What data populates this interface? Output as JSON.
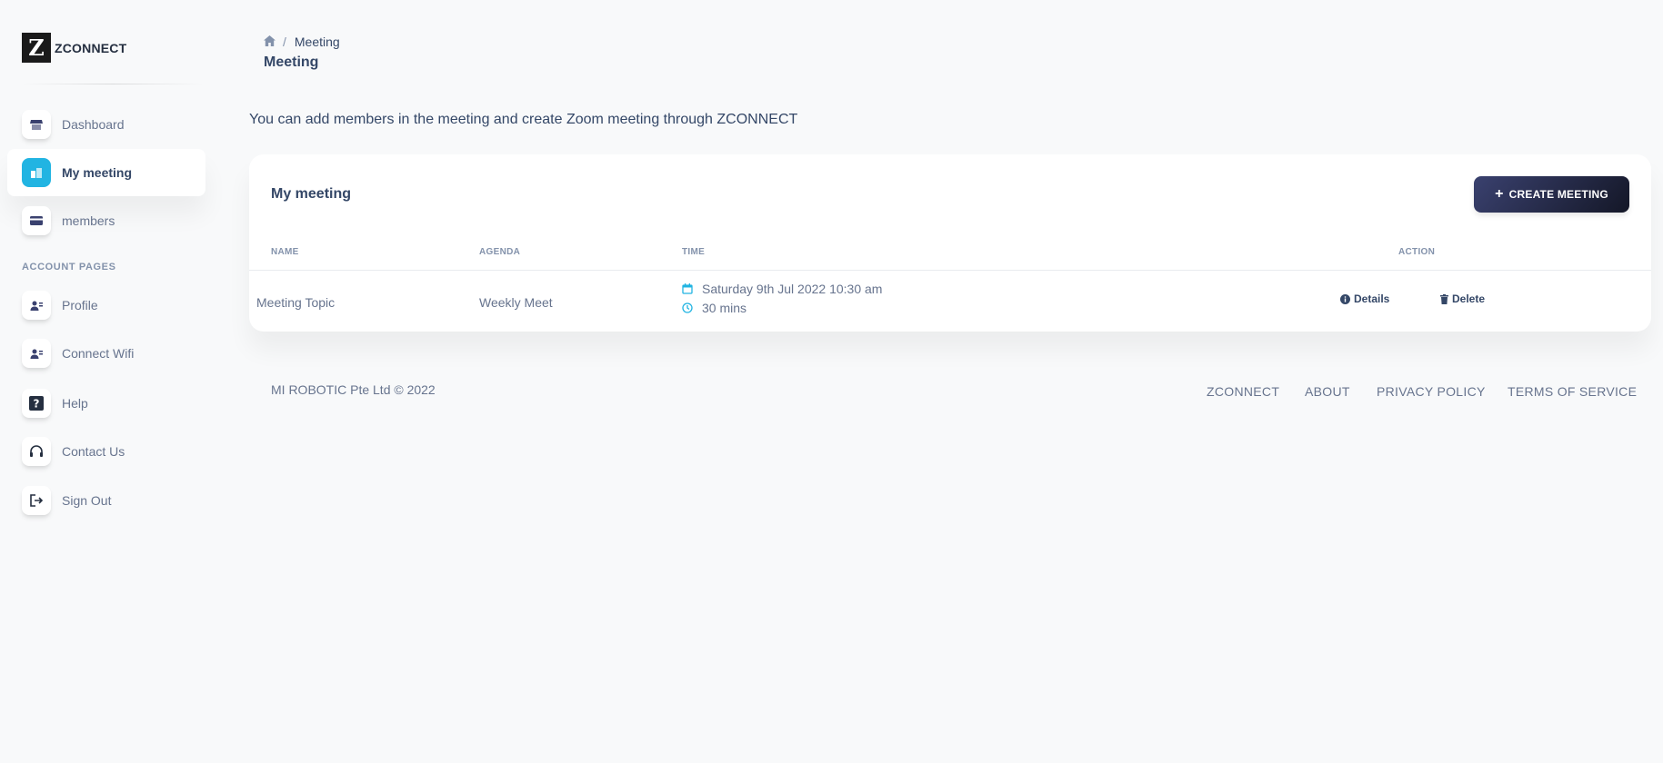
{
  "brand": {
    "logo_letter": "Z",
    "name": "ZCONNECT"
  },
  "sidebar": {
    "items": [
      {
        "label": "Dashboard",
        "icon": "shop-icon"
      },
      {
        "label": "My meeting",
        "icon": "office-icon",
        "active": true
      },
      {
        "label": "members",
        "icon": "credit-card-icon"
      }
    ],
    "section_label": "ACCOUNT PAGES",
    "account_items": [
      {
        "label": "Profile",
        "icon": "user-icon"
      },
      {
        "label": "Connect Wifi",
        "icon": "user-icon"
      },
      {
        "label": "Help",
        "icon": "question-icon"
      },
      {
        "label": "Contact Us",
        "icon": "headset-icon"
      },
      {
        "label": "Sign Out",
        "icon": "sign-out-icon"
      }
    ]
  },
  "header": {
    "breadcrumb_current": "Meeting",
    "title": "Meeting"
  },
  "intro_text": "You can add members in the meeting and create Zoom meeting through ZCONNECT",
  "card": {
    "title": "My meeting",
    "create_button": "CREATE MEETING",
    "columns": [
      "NAME",
      "AGENDA",
      "TIME",
      "ACTION"
    ],
    "rows": [
      {
        "name": "Meeting Topic",
        "agenda": "Weekly Meet",
        "date": "Saturday 9th Jul 2022 10:30 am",
        "duration": "30 mins",
        "details_label": "Details",
        "delete_label": "Delete"
      }
    ]
  },
  "footer": {
    "copyright": "MI ROBOTIC Pte Ltd © 2022",
    "links": [
      "ZCONNECT",
      "ABOUT",
      "PRIVACY POLICY",
      "TERMS OF SERVICE"
    ]
  },
  "colors": {
    "accent": "#21b4e2",
    "dark_button": "#141727",
    "text": "#344767",
    "muted": "#67748e"
  }
}
